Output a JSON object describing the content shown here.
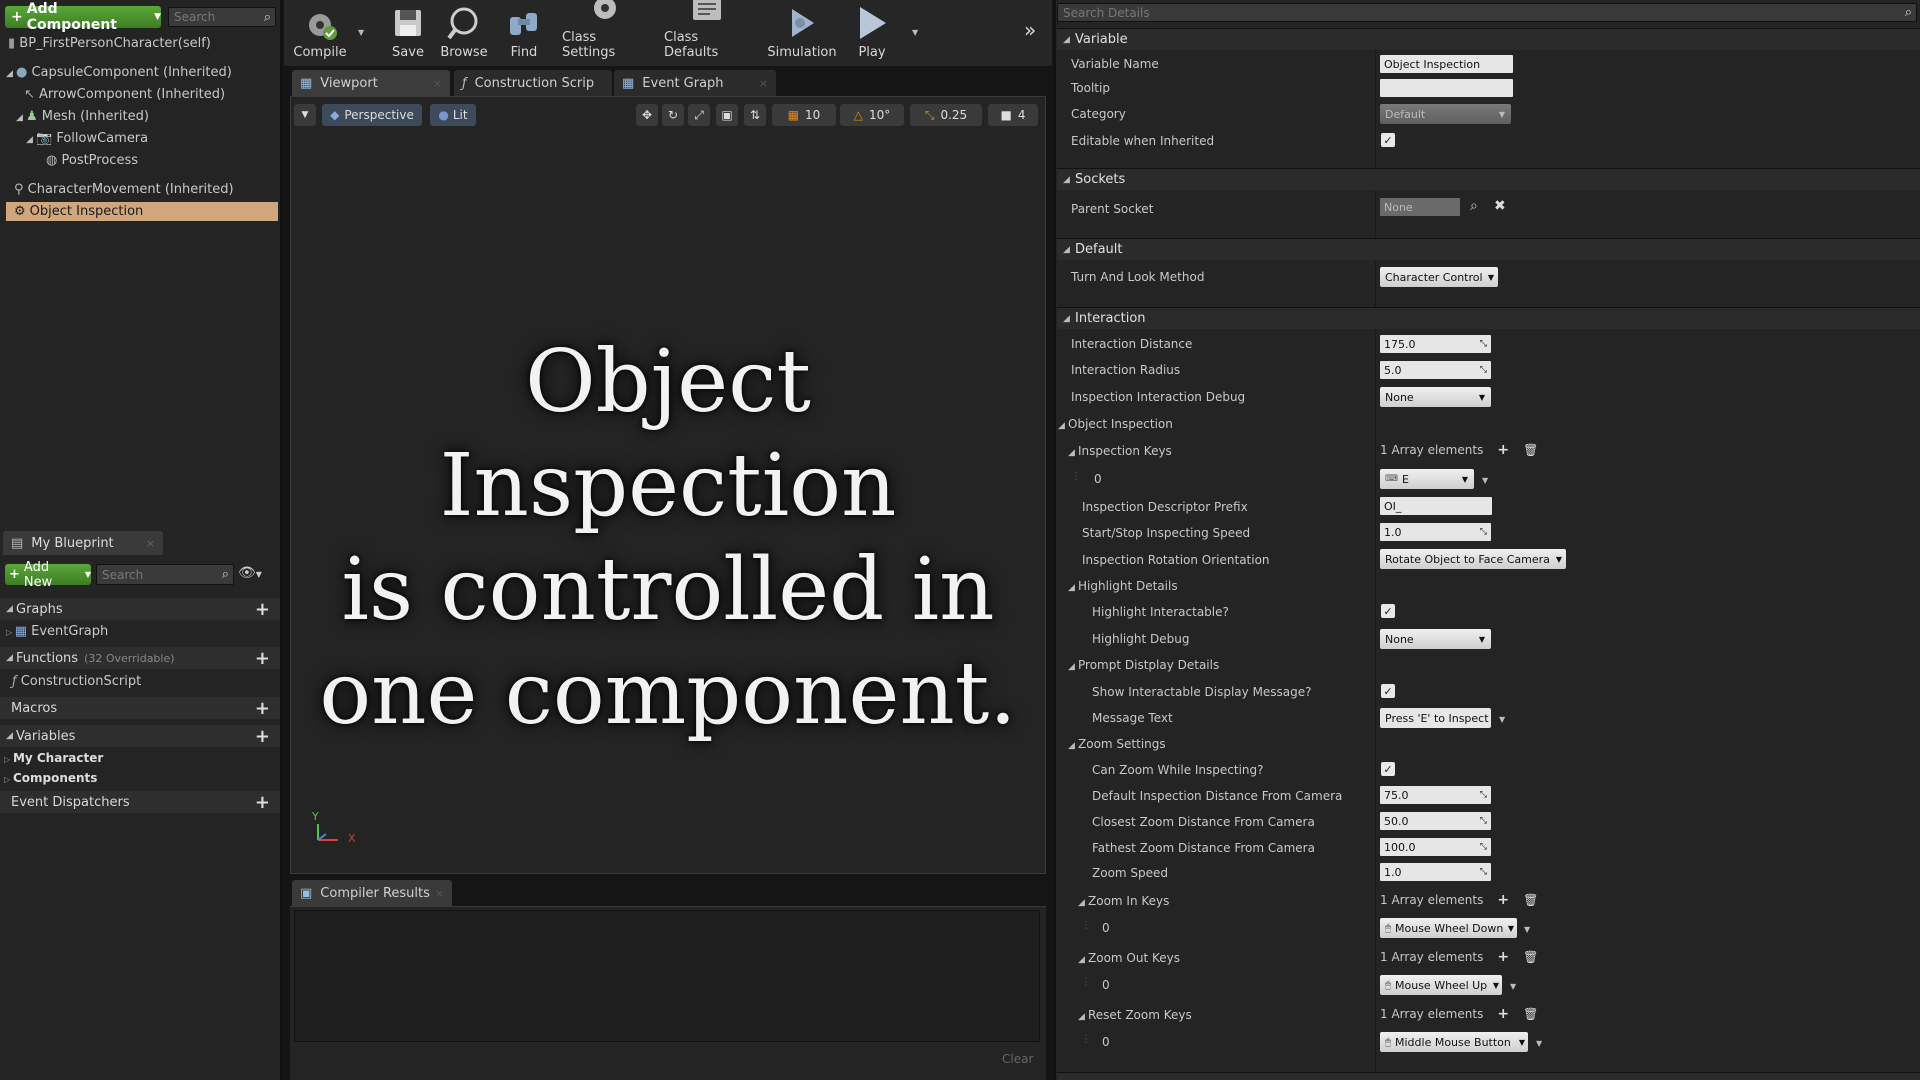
{
  "components_panel": {
    "add_component_label": "Add Component",
    "search_placeholder": "Search",
    "root": "BP_FirstPersonCharacter(self)",
    "items": [
      "CapsuleComponent (Inherited)",
      "ArrowComponent (Inherited)",
      "Mesh (Inherited)",
      "FollowCamera",
      "PostProcess",
      "CharacterMovement (Inherited)",
      "Object Inspection"
    ]
  },
  "my_blueprint": {
    "tab_label": "My Blueprint",
    "add_new_label": "Add New",
    "search_placeholder": "Search",
    "graphs_label": "Graphs",
    "event_graph_label": "EventGraph",
    "functions_label": "Functions",
    "functions_note": "(32 Overridable)",
    "construction_script_label": "ConstructionScript",
    "macros_label": "Macros",
    "variables_label": "Variables",
    "my_character_label": "My Character",
    "components_label": "Components",
    "event_dispatchers_label": "Event Dispatchers"
  },
  "toolbar": {
    "compile": "Compile",
    "save": "Save",
    "browse": "Browse",
    "find": "Find",
    "class_settings": "Class Settings",
    "class_defaults": "Class Defaults",
    "simulation": "Simulation",
    "play": "Play"
  },
  "editor_tabs": [
    "Viewport",
    "Construction Scrip",
    "Event Graph"
  ],
  "viewport": {
    "perspective": "Perspective",
    "lit": "Lit",
    "grid_snap": "10",
    "rot_snap": "10°",
    "scale_snap": "0.25",
    "camera_speed": "4",
    "overlay_lines": [
      "Object Inspection",
      "is controlled in",
      "one component."
    ],
    "axis_y": "Y",
    "axis_x": "X"
  },
  "compiler": {
    "tab_label": "Compiler Results",
    "clear_label": "Clear"
  },
  "details": {
    "search_placeholder": "Search Details",
    "variable_section": "Variable",
    "variable_name_label": "Variable Name",
    "variable_name_value": "Object Inspection",
    "tooltip_label": "Tooltip",
    "category_label": "Category",
    "category_value": "Default",
    "editable_label": "Editable when Inherited",
    "sockets_section": "Sockets",
    "parent_socket_label": "Parent Socket",
    "parent_socket_value": "None",
    "default_section": "Default",
    "turn_look_label": "Turn And Look Method",
    "turn_look_value": "Character Control",
    "interaction_section": "Interaction",
    "interaction_distance_label": "Interaction Distance",
    "interaction_distance_value": "175.0",
    "interaction_radius_label": "Interaction Radius",
    "interaction_radius_value": "5.0",
    "inspection_debug_label": "Inspection Interaction Debug",
    "inspection_debug_value": "None",
    "object_inspection_label": "Object Inspection",
    "inspection_keys_label": "Inspection Keys",
    "array_1": "1 Array elements",
    "index_0": "0",
    "inspection_key_value": "E",
    "descriptor_prefix_label": "Inspection Descriptor Prefix",
    "descriptor_prefix_value": "OI_",
    "start_stop_label": "Start/Stop Inspecting Speed",
    "start_stop_value": "1.0",
    "rotation_orientation_label": "Inspection Rotation Orientation",
    "rotation_orientation_value": "Rotate Object to Face Camera",
    "highlight_details_label": "Highlight Details",
    "highlight_interactable_label": "Highlight Interactable?",
    "highlight_debug_label": "Highlight Debug",
    "highlight_debug_value": "None",
    "prompt_details_label": "Prompt Distplay Details",
    "show_message_label": "Show Interactable Display Message?",
    "message_text_label": "Message Text",
    "message_text_value": "Press 'E' to Inspect",
    "zoom_settings_label": "Zoom Settings",
    "can_zoom_label": "Can Zoom While Inspecting?",
    "default_distance_label": "Default Inspection Distance From Camera",
    "default_distance_value": "75.0",
    "closest_zoom_label": "Closest Zoom Distance From Camera",
    "closest_zoom_value": "50.0",
    "farthest_zoom_label": "Fathest Zoom Distance From Camera",
    "farthest_zoom_value": "100.0",
    "zoom_speed_label": "Zoom Speed",
    "zoom_speed_value": "1.0",
    "zoom_in_keys_label": "Zoom In Keys",
    "zoom_in_value": "Mouse Wheel Down",
    "zoom_out_keys_label": "Zoom Out Keys",
    "zoom_out_value": "Mouse Wheel Up",
    "reset_zoom_keys_label": "Reset Zoom Keys",
    "reset_zoom_value": "Middle Mouse Button"
  }
}
